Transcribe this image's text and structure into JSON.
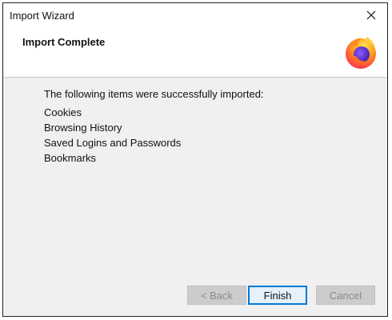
{
  "window": {
    "title": "Import Wizard"
  },
  "header": {
    "title": "Import Complete",
    "logo_icon": "firefox-logo-icon"
  },
  "content": {
    "intro": "The following items were successfully imported:",
    "items": [
      "Cookies",
      "Browsing History",
      "Saved Logins and Passwords",
      "Bookmarks"
    ]
  },
  "buttons": {
    "back_label": "< Back",
    "finish_label": "Finish",
    "cancel_label": "Cancel"
  },
  "colors": {
    "default_button_border": "#0078d7",
    "window_background": "#f0f0f0"
  }
}
